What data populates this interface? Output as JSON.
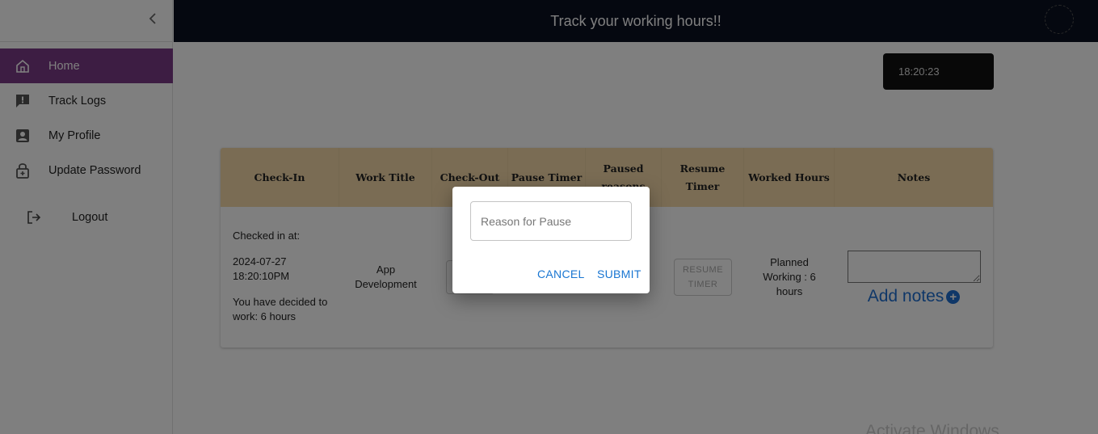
{
  "header": {
    "title": "Track your working hours!!"
  },
  "sidebar": {
    "items": [
      {
        "label": "Home",
        "icon": "home-icon",
        "active": true
      },
      {
        "label": "Track Logs",
        "icon": "feedback-icon"
      },
      {
        "label": "My Profile",
        "icon": "profile-icon"
      },
      {
        "label": "Update Password",
        "icon": "lock-icon"
      }
    ],
    "logout_label": "Logout"
  },
  "clock": {
    "time": "18:20:23"
  },
  "table": {
    "headers": [
      "Check-In",
      "Work Title",
      "Check-Out",
      "Pause Timer",
      "Paused reasons",
      "Resume Timer",
      "Worked Hours",
      "Notes"
    ],
    "row": {
      "checkin_label": "Checked in at:",
      "checkin_date": "2024-07-27",
      "checkin_time": "18:20:10PM",
      "decided": "You have decided to work: 6 hours",
      "work_title": "App Development",
      "resume_button": "RESUME TIMER",
      "worked_hours": "Planned Working : 6 hours",
      "add_notes": "Add notes"
    }
  },
  "dialog": {
    "placeholder": "Reason for Pause",
    "cancel": "CANCEL",
    "submit": "SUBMIT"
  },
  "watermark": "Activate Windows",
  "colors": {
    "accent": "#7b3a86",
    "header_bg": "#0b1020",
    "table_header": "#f4d8a8",
    "link": "#1976d2"
  }
}
